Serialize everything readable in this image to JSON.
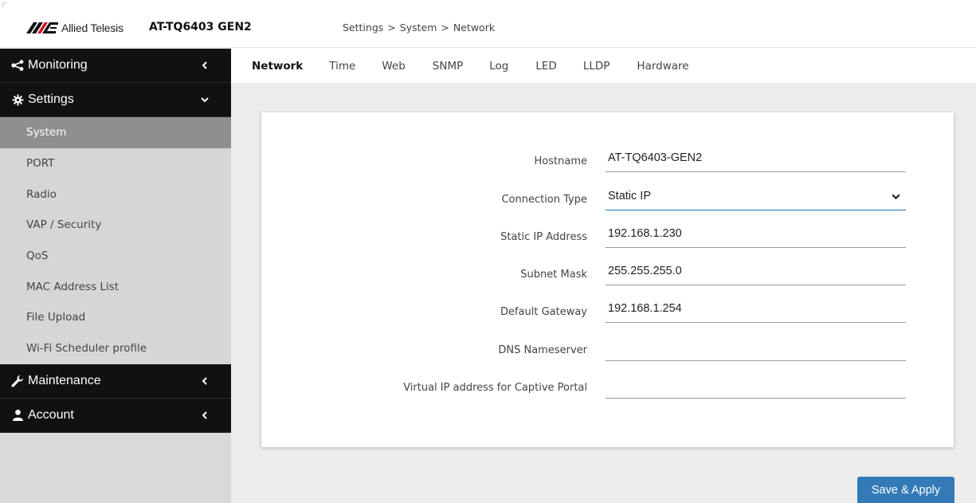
{
  "header": {
    "brand": "Allied Telesis",
    "product": "AT-TQ6403 GEN2",
    "breadcrumb": [
      "Settings",
      ">",
      "System",
      ">",
      "Network"
    ]
  },
  "sidebar": {
    "groups": [
      {
        "label": "Monitoring",
        "icon": "share-icon",
        "chevron": "chevron-left-icon"
      },
      {
        "label": "Settings",
        "icon": "gear-icon",
        "chevron": "chevron-down-icon"
      },
      {
        "label": "Maintenance",
        "icon": "wrench-icon",
        "chevron": "chevron-left-icon"
      },
      {
        "label": "Account",
        "icon": "user-icon",
        "chevron": "chevron-left-icon"
      }
    ],
    "settings_items": [
      {
        "label": "System",
        "active": true
      },
      {
        "label": "PORT"
      },
      {
        "label": "Radio"
      },
      {
        "label": "VAP / Security"
      },
      {
        "label": "QoS"
      },
      {
        "label": "MAC Address List"
      },
      {
        "label": "File Upload"
      },
      {
        "label": "Wi-Fi Scheduler profile"
      }
    ]
  },
  "tabs": [
    "Network",
    "Time",
    "Web",
    "SNMP",
    "Log",
    "LED",
    "LLDP",
    "Hardware"
  ],
  "active_tab": "Network",
  "form": {
    "hostname": {
      "label": "Hostname",
      "value": "AT-TQ6403-GEN2"
    },
    "connection_type": {
      "label": "Connection Type",
      "value": "Static IP"
    },
    "static_ip": {
      "label": "Static IP Address",
      "value": "192.168.1.230"
    },
    "subnet_mask": {
      "label": "Subnet Mask",
      "value": "255.255.255.0"
    },
    "default_gateway": {
      "label": "Default Gateway",
      "value": "192.168.1.254"
    },
    "dns": {
      "label": "DNS Nameserver",
      "value": ""
    },
    "virtual_ip": {
      "label": "Virtual IP address for Captive Portal",
      "value": ""
    }
  },
  "actions": {
    "save_apply": "Save & Apply"
  },
  "colors": {
    "accent": "#337ab7",
    "sidebar_dark": "#111111",
    "active_item": "#8f8f8f",
    "brand_red": "#e2001a"
  }
}
